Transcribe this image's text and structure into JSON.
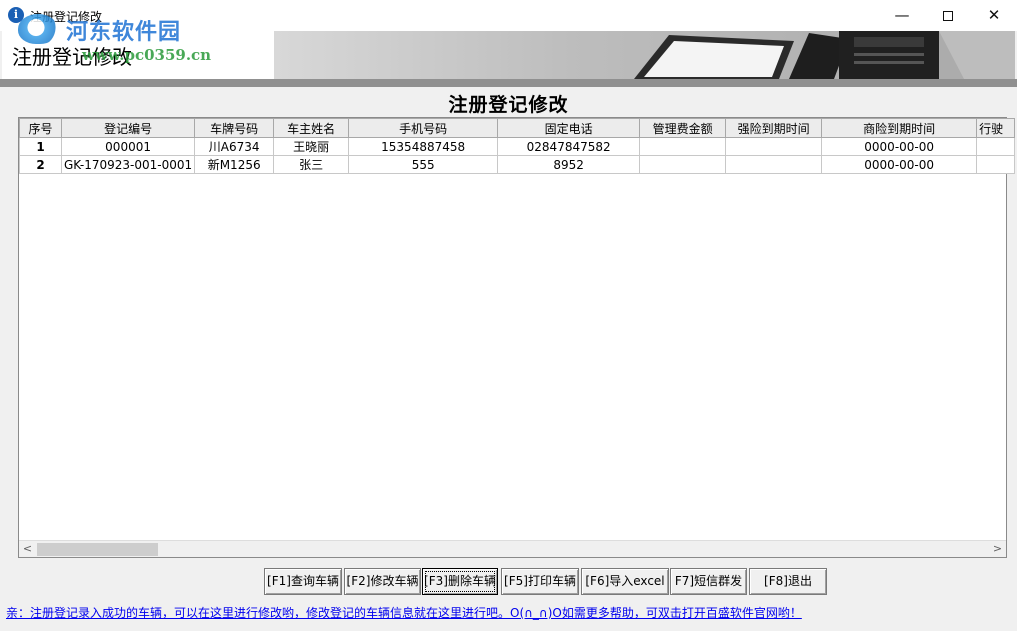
{
  "window": {
    "title": "注册登记修改",
    "icon": "info-icon",
    "minimize": "—",
    "close": "✕"
  },
  "banner": {
    "title": "注册登记修改"
  },
  "watermark": {
    "name": "河东软件园",
    "url": "www.pc0359.cn"
  },
  "panel": {
    "title": "注册登记修改"
  },
  "table": {
    "columns": [
      "序号",
      "登记编号",
      "车牌号码",
      "车主姓名",
      "手机号码",
      "固定电话",
      "管理费金额",
      "强险到期时间",
      "商险到期时间",
      "行驶"
    ],
    "rows": [
      [
        "1",
        "000001",
        "川A6734",
        "王晓丽",
        "15354887458",
        "02847847582",
        "",
        "",
        "0000-00-00",
        ""
      ],
      [
        "2",
        "GK-170923-001-0001",
        "新M1256",
        "张三",
        "555",
        "8952",
        "",
        "",
        "0000-00-00",
        ""
      ]
    ]
  },
  "scroll": {
    "left": "<",
    "right": ">"
  },
  "buttons": {
    "query": "[F1]查询车辆",
    "modify": "[F2]修改车辆",
    "delete": "[F3]删除车辆",
    "print": "[F5]打印车辆",
    "import": "[F6]导入excel",
    "sms": "F7]短信群发",
    "exit": "[F8]退出"
  },
  "status": "亲：注册登记录入成功的车辆，可以在这里进行修改哟，修改登记的车辆信息就在这里进行吧。O(∩_∩)O如需更多帮助，可双击打开百盛软件官网哟！"
}
